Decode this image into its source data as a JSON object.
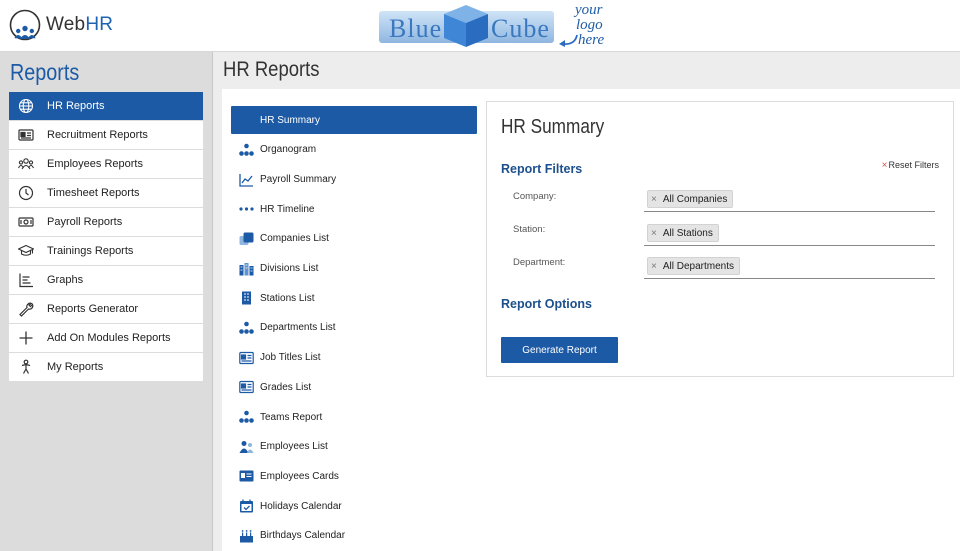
{
  "brand": {
    "name_prefix": "Web",
    "name_suffix": "HR"
  },
  "logo": {
    "word1": "Blue",
    "word2": "Cube",
    "tagline": [
      "your",
      "logo",
      "here"
    ]
  },
  "sidebar": {
    "title": "Reports",
    "items": [
      {
        "label": "HR Reports",
        "icon": "globe-icon",
        "active": true
      },
      {
        "label": "Recruitment Reports",
        "icon": "id-card-icon"
      },
      {
        "label": "Employees Reports",
        "icon": "people-icon"
      },
      {
        "label": "Timesheet Reports",
        "icon": "clock-icon"
      },
      {
        "label": "Payroll Reports",
        "icon": "money-icon"
      },
      {
        "label": "Trainings Reports",
        "icon": "graduation-cap-icon"
      },
      {
        "label": "Graphs",
        "icon": "bar-graph-icon"
      },
      {
        "label": "Reports Generator",
        "icon": "wrench-icon"
      },
      {
        "label": "Add On Modules Reports",
        "icon": "plus-icon"
      },
      {
        "label": "My Reports",
        "icon": "person-icon"
      }
    ]
  },
  "page": {
    "title": "HR Reports"
  },
  "reports": [
    {
      "label": "HR Summary",
      "icon": "",
      "active": true
    },
    {
      "label": "Organogram",
      "icon": "org-chart-icon"
    },
    {
      "label": "Payroll Summary",
      "icon": "line-chart-icon"
    },
    {
      "label": "HR Timeline",
      "icon": "dots-icon"
    },
    {
      "label": "Companies List",
      "icon": "companies-icon"
    },
    {
      "label": "Divisions List",
      "icon": "buildings-icon"
    },
    {
      "label": "Stations List",
      "icon": "building-icon"
    },
    {
      "label": "Departments List",
      "icon": "org-chart-icon"
    },
    {
      "label": "Job Titles List",
      "icon": "id-card-icon"
    },
    {
      "label": "Grades List",
      "icon": "id-card-icon"
    },
    {
      "label": "Teams Report",
      "icon": "org-chart-icon"
    },
    {
      "label": "Employees List",
      "icon": "people-icon"
    },
    {
      "label": "Employees Cards",
      "icon": "card-icon"
    },
    {
      "label": "Holidays Calendar",
      "icon": "calendar-check-icon"
    },
    {
      "label": "Birthdays Calendar",
      "icon": "cake-icon"
    }
  ],
  "summary": {
    "title": "HR Summary",
    "filters_heading": "Report Filters",
    "reset_label": "Reset Filters",
    "filters": [
      {
        "label": "Company:",
        "value": "All Companies"
      },
      {
        "label": "Station:",
        "value": "All Stations"
      },
      {
        "label": "Department:",
        "value": "All Departments"
      }
    ],
    "options_heading": "Report Options",
    "generate_label": "Generate Report"
  },
  "colors": {
    "accent": "#1c5aa6",
    "heading": "#1c4f8c",
    "sidebar_bg": "#dcdcdc"
  }
}
